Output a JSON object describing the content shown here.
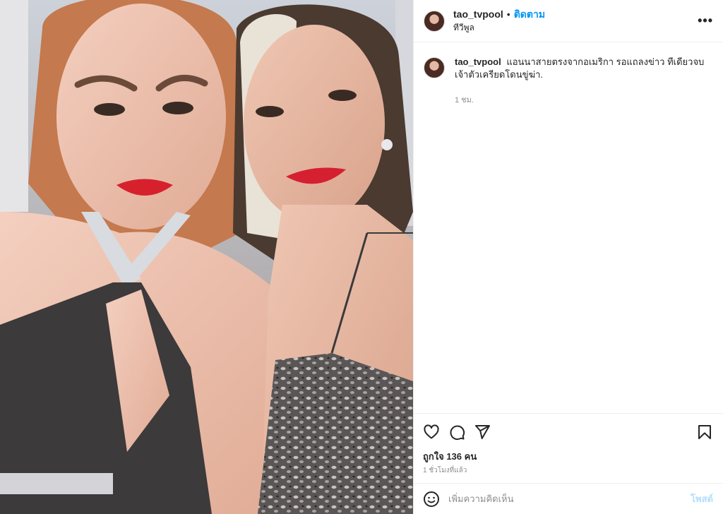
{
  "post": {
    "username": "tao_tvpool",
    "follow_label": "ติดตาม",
    "separator": "•",
    "location": "ทีวีพูล",
    "more_label": "•••",
    "caption": "แอนนาสายตรงจากอเมริกา รอแถลงข่าว ทีเดียวจบ เจ้าตัวเครียดโดนขู่ฆ่า.",
    "caption_time": "1 ชม.",
    "likes": "ถูกใจ 136 คน",
    "time_ago": "1 ชั่วโมงที่แล้ว",
    "comment_placeholder": "เพิ่มความคิดเห็น",
    "post_button": "โพสต์"
  },
  "icons": {
    "avatar": "avatar",
    "like": "heart-icon",
    "comment": "comment-icon",
    "share": "send-icon",
    "save": "bookmark-icon",
    "emoji": "smiley-icon",
    "more": "more-icon"
  },
  "colors": {
    "accent": "#0095f6",
    "muted": "#8e8e8e",
    "post_disabled": "#b2dffc",
    "text": "#262626"
  }
}
